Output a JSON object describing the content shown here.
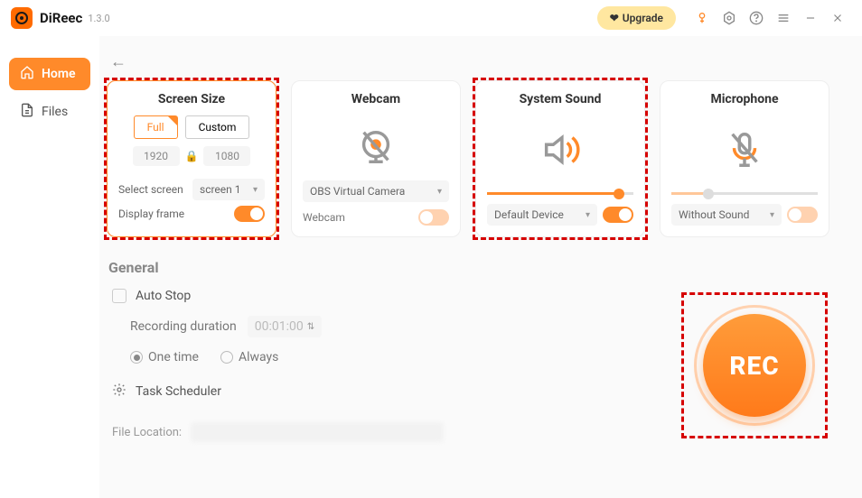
{
  "app": {
    "name": "DiReec",
    "version": "1.3.0"
  },
  "titlebar": {
    "upgrade": "Upgrade"
  },
  "sidebar": {
    "items": [
      {
        "label": "Home",
        "active": true
      },
      {
        "label": "Files",
        "active": false
      }
    ]
  },
  "cards": {
    "screen": {
      "title": "Screen Size",
      "tab_full": "Full",
      "tab_custom": "Custom",
      "width": "1920",
      "height": "1080",
      "select_label": "Select screen",
      "select_value": "screen 1",
      "frame_label": "Display frame",
      "frame_on": true,
      "highlighted": true,
      "selected": true
    },
    "webcam": {
      "title": "Webcam",
      "device": "OBS Virtual Camera",
      "label": "Webcam",
      "on": false,
      "highlighted": false
    },
    "system_sound": {
      "title": "System Sound",
      "device": "Default Device",
      "on": true,
      "highlighted": true
    },
    "microphone": {
      "title": "Microphone",
      "device": "Without Sound",
      "on": false,
      "highlighted": false
    }
  },
  "general": {
    "title": "General",
    "autostop": "Auto Stop",
    "duration_label": "Recording duration",
    "duration_value": "00:01:00",
    "onetime": "One time",
    "always": "Always",
    "onetime_checked": true,
    "task_scheduler": "Task Scheduler",
    "file_location_label": "File Location:"
  },
  "rec": {
    "label": "REC"
  }
}
